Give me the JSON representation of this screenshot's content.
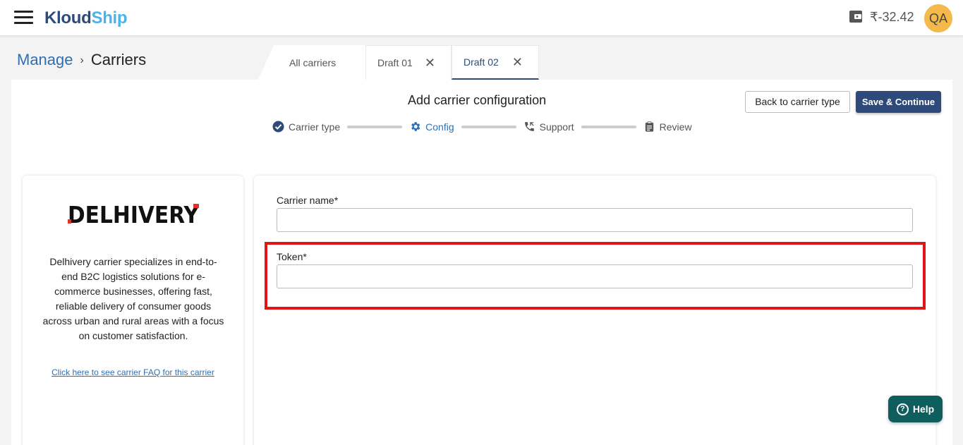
{
  "app": {
    "logo_part1": "Kloud",
    "logo_part2": "Ship"
  },
  "header": {
    "balance": "₹-32.42",
    "avatar_initials": "QA"
  },
  "breadcrumb": {
    "parent": "Manage",
    "separator": "›",
    "current": "Carriers"
  },
  "tabs": [
    {
      "label": "All carriers"
    },
    {
      "label": "Draft 01",
      "close": "✕"
    },
    {
      "label": "Draft 02",
      "close": "✕"
    }
  ],
  "page": {
    "title": "Add carrier configuration",
    "back_button": "Back to carrier type",
    "save_button": "Save & Continue"
  },
  "stepper": [
    {
      "label": "Carrier type",
      "icon": "check-circle-icon"
    },
    {
      "label": "Config",
      "icon": "gear-icon"
    },
    {
      "label": "Support",
      "icon": "phone-icon"
    },
    {
      "label": "Review",
      "icon": "clipboard-icon"
    }
  ],
  "carrier": {
    "logo_text": "DELHIVERY",
    "description": "Delhivery carrier specializes in end-to-end B2C logistics solutions for e-commerce businesses, offering fast, reliable delivery of consumer goods across urban and rural areas with a focus on customer satisfaction.",
    "faq_link": "Click here to see carrier FAQ for this carrier"
  },
  "form": {
    "carrier_name_label": "Carrier name*",
    "carrier_name_value": "",
    "token_label": "Token*",
    "token_value": ""
  },
  "help": {
    "label": "Help"
  },
  "colors": {
    "primary": "#2d4a7a",
    "accent": "#2f6fb3",
    "logo_light": "#4cb3e8",
    "avatar": "#f5b84a",
    "highlight": "#e0141b",
    "help": "#0f5e5e"
  }
}
